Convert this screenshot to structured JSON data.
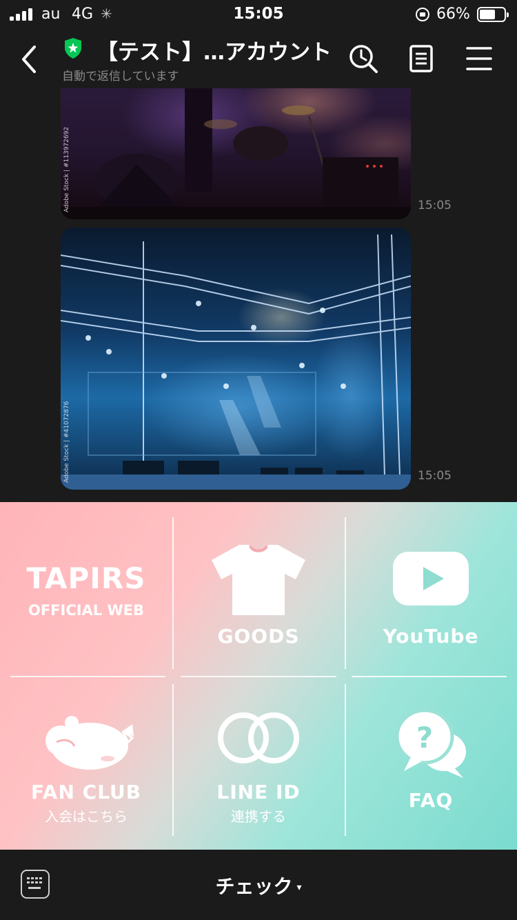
{
  "status_bar": {
    "carrier": "au",
    "network": "4G",
    "time": "15:05",
    "battery_percent": "66%",
    "battery_level": 0.66
  },
  "header": {
    "title": "【テスト】…アカウント",
    "subtitle": "自動で返信しています"
  },
  "chat": {
    "messages": [
      {
        "type": "image",
        "watermark": "Adobe Stock | #113972692",
        "time": "15:05"
      },
      {
        "type": "image",
        "watermark": "Adobe Stock | #41072876",
        "time": "15:05"
      }
    ]
  },
  "rich_menu": {
    "cells": [
      {
        "title": "TAPIRS",
        "subtitle": "OFFICIAL WEB"
      },
      {
        "label": "GOODS",
        "icon": "tshirt-icon"
      },
      {
        "label": "YouTube",
        "icon": "youtube-icon"
      },
      {
        "label": "FAN CLUB",
        "sublabel": "入会はこちら",
        "icon": "tapir-icon"
      },
      {
        "label": "LINE ID",
        "sublabel": "連携する",
        "icon": "rings-icon"
      },
      {
        "label": "FAQ",
        "icon": "question-bubble-icon"
      }
    ]
  },
  "bottom_bar": {
    "menu_label": "チェック",
    "caret": "▾"
  },
  "colors": {
    "background": "#1b1b1b",
    "badge_green": "#06c755",
    "menu_pink": "#ffb4b9",
    "menu_mint": "#7adbce"
  }
}
